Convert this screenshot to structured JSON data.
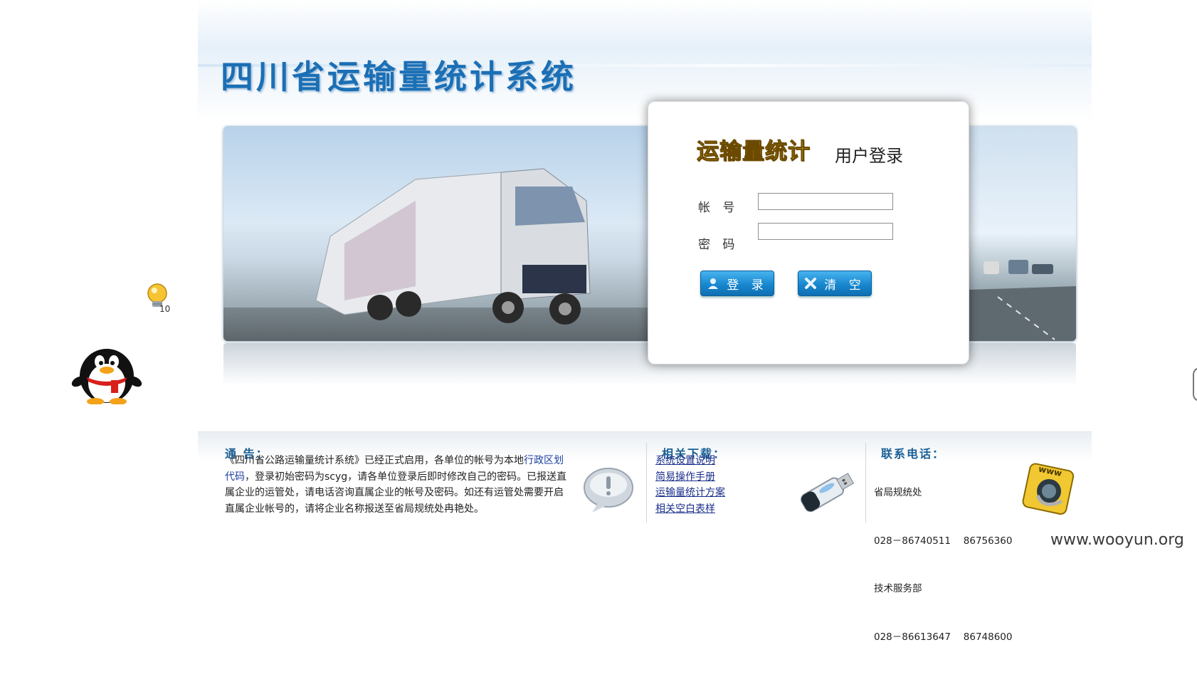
{
  "header": {
    "title": "四川省运输量统计系统"
  },
  "login": {
    "title_highlight": "运输量统计",
    "title_rest": "用户登录",
    "account_label": "帐 号",
    "password_label": "密 码",
    "account_value": "",
    "password_value": "",
    "login_button": "登 录",
    "clear_button": "清 空"
  },
  "notice": {
    "title": "通 告：",
    "text_part1": "《四川省公路运输量统计系统》已经正式启用，各单位的帐号为本地",
    "text_link": "行政区划代码",
    "text_part2": "，登录初始密码为scyg，请各单位登录后即时修改自己的密码。已报送直属企业的运管处，请电话咨询直属企业的帐号及密码。如还有运管处需要开启直属企业帐号的，请将企业名称报送至省局规统处冉艳处。"
  },
  "downloads": {
    "title": "相关下载：",
    "items": [
      "系统设置说明",
      "简易操作手册",
      "运输量统计方案",
      "相关空白表样"
    ]
  },
  "contact": {
    "title": "联系电话：",
    "lines": [
      "省局规统处",
      "028－86740511　 86756360",
      "技术服务部",
      "028－86613647　 86748600"
    ]
  },
  "floating": {
    "bulb_count": "10"
  },
  "watermark": "www.wooyun.org",
  "colors": {
    "title_blue": "#1b6fb5",
    "button_blue": "#1887cf",
    "gold": "#f3c21c",
    "section_title": "#1a5f96",
    "link": "#1a2f8a"
  },
  "icons": [
    "user-icon",
    "clear-x-icon",
    "speech-bubble-icon",
    "usb-drive-icon",
    "www-phone-icon",
    "qq-penguin-icon",
    "lightbulb-icon"
  ]
}
